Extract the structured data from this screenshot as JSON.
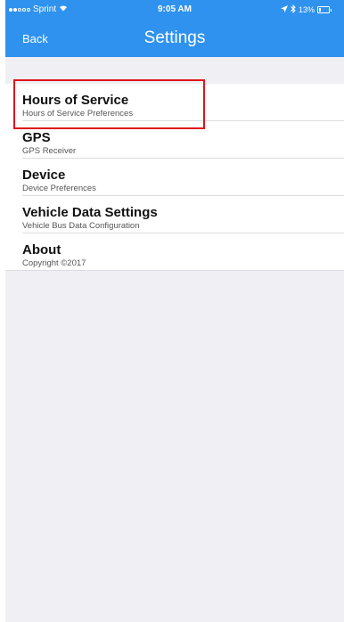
{
  "status_bar": {
    "carrier": "Sprint",
    "time": "9:05 AM",
    "battery": "13%"
  },
  "nav": {
    "back_label": "Back",
    "title": "Settings"
  },
  "settings": {
    "items": [
      {
        "title": "Hours of Service",
        "subtitle": "Hours of Service Preferences"
      },
      {
        "title": "GPS",
        "subtitle": "GPS Receiver"
      },
      {
        "title": "Device",
        "subtitle": "Device Preferences"
      },
      {
        "title": "Vehicle Data Settings",
        "subtitle": "Vehicle Bus Data Configuration"
      },
      {
        "title": "About",
        "subtitle": "Copyright ©2017"
      }
    ]
  },
  "colors": {
    "nav_background": "#2f92ee",
    "highlight": "#e0141a"
  }
}
